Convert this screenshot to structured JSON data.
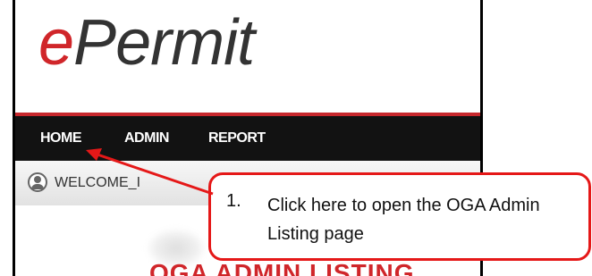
{
  "logo": {
    "e": "e",
    "rest": "Permit"
  },
  "nav": {
    "items": [
      "HOME",
      "ADMIN",
      "REPORT"
    ]
  },
  "welcome": {
    "text": "WELCOME_I",
    "icon": "user-icon"
  },
  "main": {
    "title": "OGA ADMIN LISTING"
  },
  "callout": {
    "number": "1.",
    "text": "Click here to open the OGA Admin Listing page"
  },
  "colors": {
    "accent": "#d0262a",
    "nav_bg": "#121212",
    "callout_border": "#e51818"
  }
}
